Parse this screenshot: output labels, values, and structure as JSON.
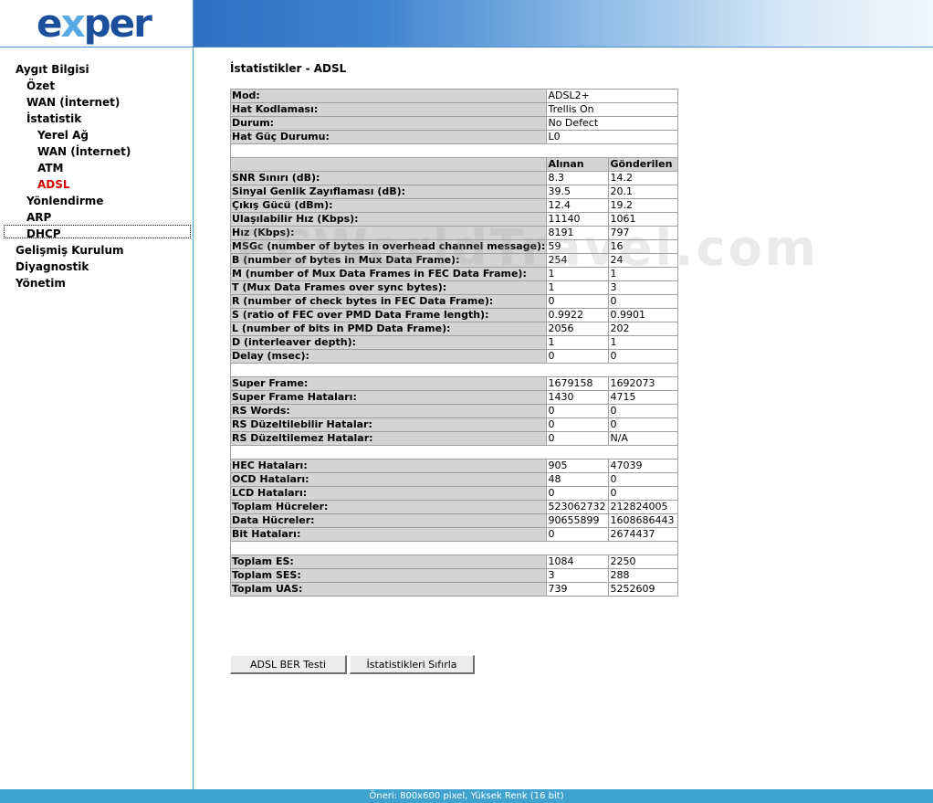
{
  "brand": {
    "logo_e": "e",
    "logo_x": "x",
    "logo_rest": "per"
  },
  "sidebar": {
    "items": [
      {
        "label": "Aygıt Bilgisi"
      },
      {
        "label": "Özet"
      },
      {
        "label": "WAN (İnternet)"
      },
      {
        "label": "İstatistik"
      },
      {
        "label": "Yerel Ağ"
      },
      {
        "label": "WAN (İnternet)"
      },
      {
        "label": "ATM"
      },
      {
        "label": "ADSL"
      },
      {
        "label": "Yönlendirme"
      },
      {
        "label": "ARP"
      },
      {
        "label": "DHCP"
      },
      {
        "label": "Gelişmiş Kurulum"
      },
      {
        "label": "Diyagnostik"
      },
      {
        "label": "Yönetim"
      }
    ]
  },
  "main": {
    "title": "İstatistikler - ADSL",
    "info": [
      {
        "label": "Mod:",
        "value": "ADSL2+"
      },
      {
        "label": "Hat Kodlaması:",
        "value": "Trellis On"
      },
      {
        "label": "Durum:",
        "value": "No Defect"
      },
      {
        "label": "Hat Güç Durumu:",
        "value": "L0"
      }
    ],
    "col_rx": "Alınan",
    "col_tx": "Gönderilen",
    "group1": [
      {
        "label": "SNR Sınırı (dB):",
        "rx": "8.3",
        "tx": "14.2"
      },
      {
        "label": "Sinyal Genlik Zayıflaması (dB):",
        "rx": "39.5",
        "tx": "20.1"
      },
      {
        "label": "Çıkış Gücü (dBm):",
        "rx": "12.4",
        "tx": "19.2"
      },
      {
        "label": "Ulaşılabilir Hız (Kbps):",
        "rx": "11140",
        "tx": "1061"
      },
      {
        "label": "Hız (Kbps):",
        "rx": "8191",
        "tx": "797"
      },
      {
        "label": "MSGc (number of bytes in overhead channel message):",
        "rx": "59",
        "tx": "16"
      },
      {
        "label": "B (number of bytes in Mux Data Frame):",
        "rx": "254",
        "tx": "24"
      },
      {
        "label": "M (number of Mux Data Frames in FEC Data Frame):",
        "rx": "1",
        "tx": "1"
      },
      {
        "label": "T (Mux Data Frames over sync bytes):",
        "rx": "1",
        "tx": "3"
      },
      {
        "label": "R (number of check bytes in FEC Data Frame):",
        "rx": "0",
        "tx": "0"
      },
      {
        "label": "S (ratio of FEC over PMD Data Frame length):",
        "rx": "0.9922",
        "tx": "0.9901"
      },
      {
        "label": "L (number of bits in PMD Data Frame):",
        "rx": "2056",
        "tx": "202"
      },
      {
        "label": "D (interleaver depth):",
        "rx": "1",
        "tx": "1"
      },
      {
        "label": "Delay (msec):",
        "rx": "0",
        "tx": "0"
      }
    ],
    "group2": [
      {
        "label": "Super Frame:",
        "rx": "1679158",
        "tx": "1692073"
      },
      {
        "label": "Super Frame Hataları:",
        "rx": "1430",
        "tx": "4715"
      },
      {
        "label": "RS Words:",
        "rx": "0",
        "tx": "0"
      },
      {
        "label": "RS Düzeltilebilir Hatalar:",
        "rx": "0",
        "tx": "0"
      },
      {
        "label": "RS Düzeltilemez Hatalar:",
        "rx": "0",
        "tx": "N/A"
      }
    ],
    "group3": [
      {
        "label": "HEC Hataları:",
        "rx": "905",
        "tx": "47039"
      },
      {
        "label": "OCD Hataları:",
        "rx": "48",
        "tx": "0"
      },
      {
        "label": "LCD Hataları:",
        "rx": "0",
        "tx": "0"
      },
      {
        "label": "Toplam Hücreler:",
        "rx": "523062732",
        "tx": "212824005"
      },
      {
        "label": "Data Hücreler:",
        "rx": "90655899",
        "tx": "1608686443"
      },
      {
        "label": "Bit Hataları:",
        "rx": "0",
        "tx": "2674437"
      }
    ],
    "group4": [
      {
        "label": "Toplam ES:",
        "rx": "1084",
        "tx": "2250"
      },
      {
        "label": "Toplam SES:",
        "rx": "3",
        "tx": "288"
      },
      {
        "label": "Toplam UAS:",
        "rx": "739",
        "tx": "5252609"
      }
    ],
    "buttons": {
      "ber_test": "ADSL BER Testi",
      "reset": "İstatistikleri Sıfırla"
    }
  },
  "watermark": "PCWorldTravel.com",
  "footer": {
    "text": "Öneri: 800x600 pixel, Yüksek Renk (16 bit)"
  },
  "colors": {
    "banner": "#2f6fc0",
    "footer": "#3fa2cf",
    "active_nav": "#d40000",
    "label_bg": "#d4d4d4"
  }
}
